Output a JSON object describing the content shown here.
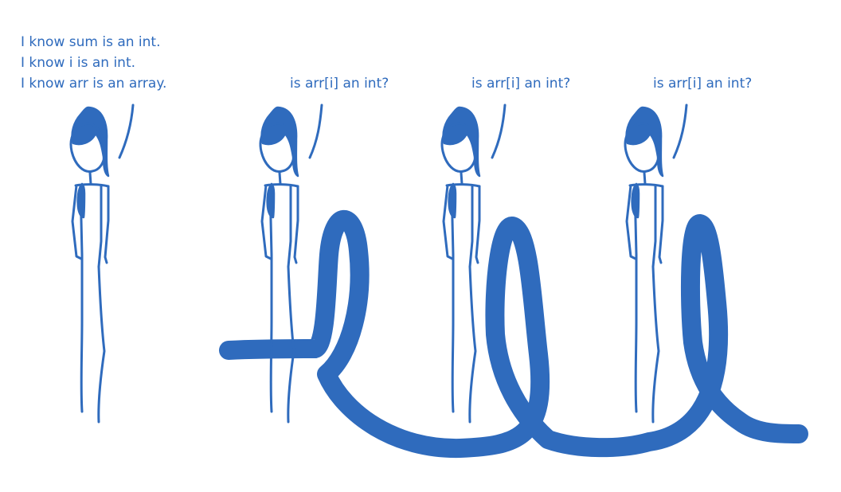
{
  "colors": {
    "ink": "#2f6bbd",
    "background": "#ffffff"
  },
  "captions": {
    "first": [
      "I know sum is an int.",
      "I know i is an int.",
      "I know arr is an array."
    ],
    "second": "is arr[i] an int?",
    "third": "is arr[i] an int?",
    "fourth": "is arr[i] an int?"
  }
}
